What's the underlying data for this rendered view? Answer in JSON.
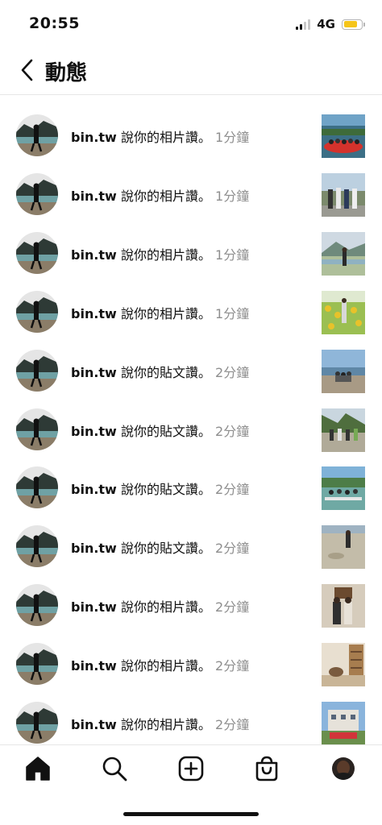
{
  "status_bar": {
    "time": "20:55",
    "network": "4G",
    "battery_color": "#f5c51a"
  },
  "header": {
    "title": "動態",
    "back_icon": "chevron-left-icon"
  },
  "notifications": [
    {
      "user": "bin.tw",
      "action": "說你的相片讚。",
      "time": "1分鐘",
      "thumb": "rafting-group-photo"
    },
    {
      "user": "bin.tw",
      "action": "說你的相片讚。",
      "time": "1分鐘",
      "thumb": "group-standing-photo"
    },
    {
      "user": "bin.tw",
      "action": "說你的相片讚。",
      "time": "1分鐘",
      "thumb": "river-person-photo"
    },
    {
      "user": "bin.tw",
      "action": "說你的相片讚。",
      "time": "1分鐘",
      "thumb": "sunflower-field-photo"
    },
    {
      "user": "bin.tw",
      "action": "說你的貼文讚。",
      "time": "2分鐘",
      "thumb": "beach-group-photo"
    },
    {
      "user": "bin.tw",
      "action": "說你的貼文讚。",
      "time": "2分鐘",
      "thumb": "mountain-group-photo"
    },
    {
      "user": "bin.tw",
      "action": "說你的貼文讚。",
      "time": "2分鐘",
      "thumb": "paddleboard-group-photo"
    },
    {
      "user": "bin.tw",
      "action": "說你的貼文讚。",
      "time": "2分鐘",
      "thumb": "sand-beach-photo"
    },
    {
      "user": "bin.tw",
      "action": "說你的相片讚。",
      "time": "2分鐘",
      "thumb": "indoor-pair-photo"
    },
    {
      "user": "bin.tw",
      "action": "說你的相片讚。",
      "time": "2分鐘",
      "thumb": "shelf-room-photo"
    },
    {
      "user": "bin.tw",
      "action": "說你的相片讚。",
      "time": "2分鐘",
      "thumb": "building-group-photo"
    }
  ],
  "tabs": [
    "home-icon",
    "search-icon",
    "new-post-icon",
    "shop-icon",
    "profile-avatar"
  ]
}
